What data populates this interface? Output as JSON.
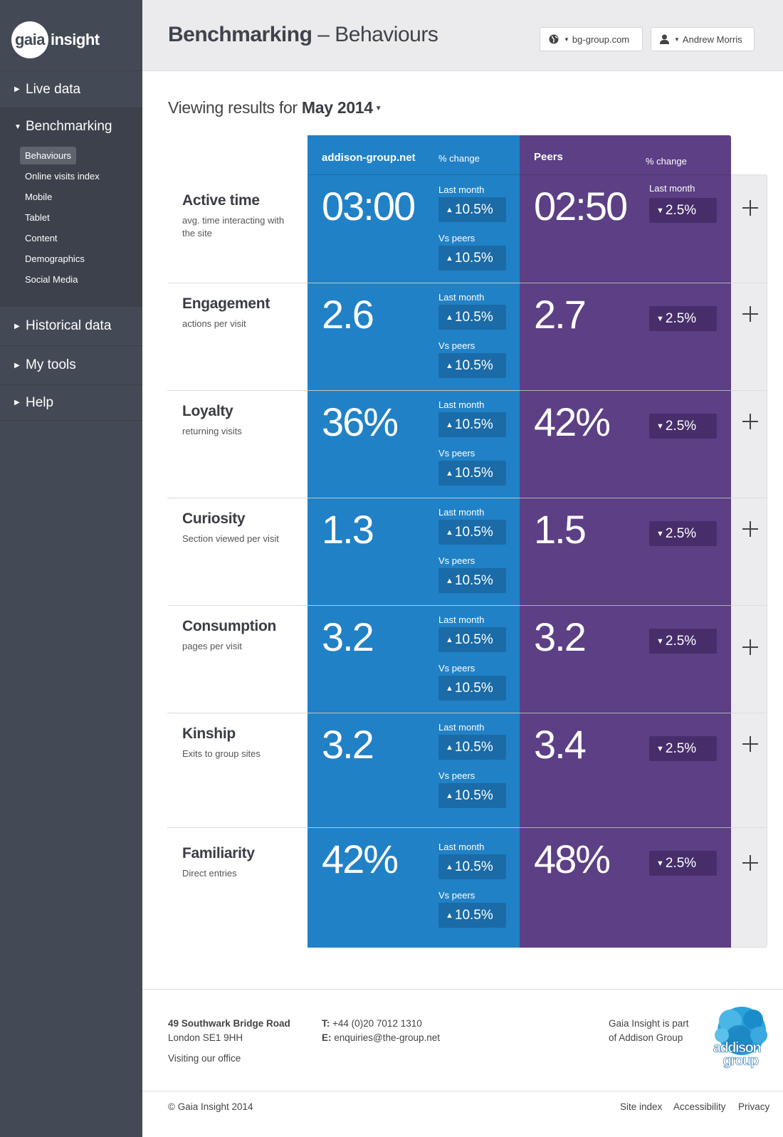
{
  "sidebar": {
    "logo_circle": "gaia",
    "logo_text": "insight",
    "nav": [
      {
        "label": "Live data"
      },
      {
        "label": "Benchmarking"
      },
      {
        "label": "Historical data"
      },
      {
        "label": "My tools"
      },
      {
        "label": "Help"
      }
    ],
    "subnav": [
      {
        "label": "Behaviours",
        "active": true
      },
      {
        "label": "Online visits index"
      },
      {
        "label": "Mobile"
      },
      {
        "label": "Tablet"
      },
      {
        "label": "Content"
      },
      {
        "label": "Demographics"
      },
      {
        "label": "Social Media"
      }
    ]
  },
  "header": {
    "title_bold": "Benchmarking",
    "title_light": " – Behaviours",
    "site_selector": "bg-group.com",
    "user_name": "Andrew Morris"
  },
  "viewing": {
    "prefix": "Viewing results for ",
    "month": "May 2014"
  },
  "table": {
    "own_column": "addison-group.net",
    "own_change_label": "% change",
    "peers_column": "Peers",
    "peers_change_label": "% change",
    "last_month_label": "Last month",
    "vs_peers_label": "Vs peers",
    "rows": [
      {
        "name": "Active time",
        "desc": "avg. time interacting with the site",
        "own_value": "03:00",
        "last_month": "10.5%",
        "vs_peers": "10.5%",
        "peer_value": "02:50",
        "peer_change": "2.5%",
        "peer_last_month_label": "Last month"
      },
      {
        "name": "Engagement",
        "desc": "actions per visit",
        "own_value": "2.6",
        "last_month": "10.5%",
        "vs_peers": "10.5%",
        "peer_value": "2.7",
        "peer_change": "2.5%"
      },
      {
        "name": "Loyalty",
        "desc": "returning visits",
        "own_value": "36%",
        "last_month": "10.5%",
        "vs_peers": "10.5%",
        "peer_value": "42%",
        "peer_change": "2.5%"
      },
      {
        "name": "Curiosity",
        "desc": "Section viewed per visit",
        "own_value": "1.3",
        "last_month": "10.5%",
        "vs_peers": "10.5%",
        "peer_value": "1.5",
        "peer_change": "2.5%"
      },
      {
        "name": "Consumption",
        "desc": "pages per visit",
        "own_value": "3.2",
        "last_month": "10.5%",
        "vs_peers": "10.5%",
        "peer_value": "3.2",
        "peer_change": "2.5%"
      },
      {
        "name": "Kinship",
        "desc": "Exits to group sites",
        "own_value": "3.2",
        "last_month": "10.5%",
        "vs_peers": "10.5%",
        "peer_value": "3.4",
        "peer_change": "2.5%"
      },
      {
        "name": "Familiarity",
        "desc": "Direct entries",
        "own_value": "42%",
        "last_month": "10.5%",
        "vs_peers": "10.5%",
        "peer_value": "48%",
        "peer_change": "2.5%"
      }
    ]
  },
  "footer": {
    "address_line1": "49 Southwark Bridge Road",
    "address_line2": "London SE1 9HH",
    "visiting": "Visiting our office",
    "phone_label": "T:",
    "phone": " +44 (0)20 7012 1310",
    "email_label": "E:",
    "email": " enquiries@the-group.net",
    "part_of_line1": "Gaia Insight is part",
    "part_of_line2": "of Addison Group",
    "addison_logo_line1": "addison",
    "addison_logo_line2": "group",
    "copyright": "© Gaia Insight 2014",
    "links": [
      "Site index",
      "Accessibility",
      "Privacy"
    ]
  },
  "colors": {
    "sidebar": "#444a55",
    "own_blue": "#2181c6",
    "peers_purple": "#5c3f84",
    "header_grey": "#ebebed"
  },
  "icons": {
    "site_selector": "globe-icon",
    "user": "user-icon",
    "expand": "plus-icon",
    "up": "triangle-up-icon",
    "down": "triangle-down-icon"
  }
}
